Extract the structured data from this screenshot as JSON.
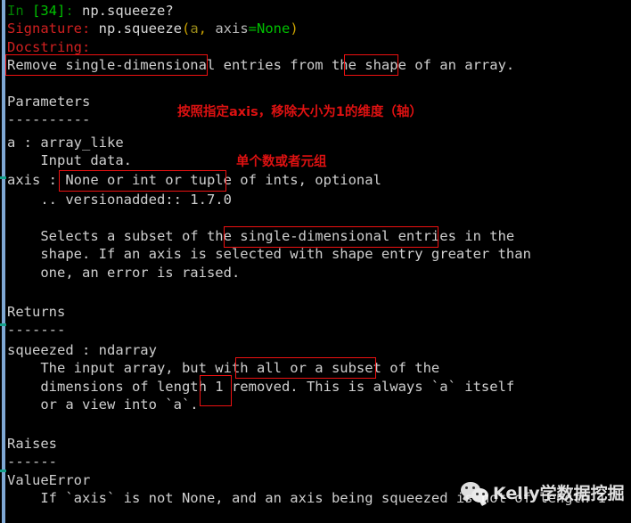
{
  "terminal": {
    "background": "#000000",
    "foreground": "#cfcfcf",
    "prompt_label": "In",
    "prompt_number": "[34]",
    "prompt_colon": ":",
    "prompt_command": " np.squeeze?",
    "signature_label": "Signature:",
    "signature_call_prefix": " np.squeeze",
    "signature_paren_open": "(",
    "signature_arg_a": "a",
    "signature_comma": ", ",
    "signature_arg_axis": "axis",
    "signature_equals": "=",
    "signature_default": "None",
    "signature_paren_close": ")",
    "docstring_label": "Docstring:",
    "lines": [
      "Remove single-dimensional entries from the shape of an array.",
      "",
      "Parameters",
      "----------",
      "a : array_like",
      "    Input data.",
      "axis : None or int or tuple of ints, optional",
      "    .. versionadded:: 1.7.0",
      "",
      "    Selects a subset of the single-dimensional entries in the",
      "    shape. If an axis is selected with shape entry greater than",
      "    one, an error is raised.",
      "",
      "",
      "Returns",
      "-------",
      "",
      "squeezed : ndarray",
      "    The input array, but with all or a subset of the",
      "    dimensions of length 1 removed. This is always `a` itself",
      "    or a view into `a`.",
      "",
      "",
      "",
      "Raises",
      "------",
      "",
      "ValueError",
      "    If `axis` is not None, and an axis being squeezed is not of length 1"
    ]
  },
  "annotations": {
    "color": "#dd1111",
    "notes": [
      {
        "text": "按照指定axis，移除大小为1的维度（轴）"
      },
      {
        "text": "单个数或者元组"
      }
    ],
    "highlight_boxes": [
      {
        "label": "Remove single-dimensional"
      },
      {
        "label": "shape"
      },
      {
        "label": "None or int or tuple"
      },
      {
        "label": "single-dimensional entries"
      },
      {
        "label": "all or a subset"
      },
      {
        "label": "1"
      }
    ]
  },
  "watermark": {
    "icon": "wechat-icon",
    "text": "Kelly学数据挖掘"
  },
  "scrollbar": {
    "name": "vertical-scrollbar",
    "color": "#7fa8d4"
  }
}
